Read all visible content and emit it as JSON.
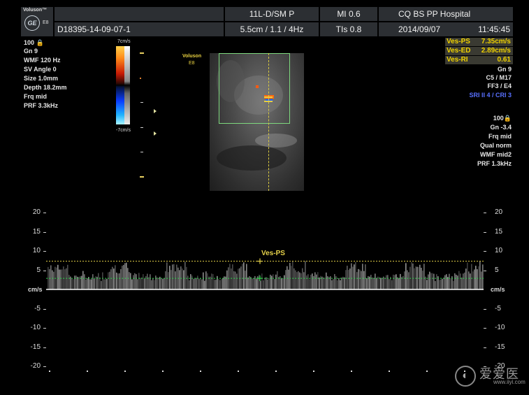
{
  "header": {
    "brand": "Voluson™",
    "model": "E8",
    "patient_id": "D18395-14-09-07-1",
    "probe": "11L-D/SM P",
    "depth_info": "5.5cm / 1.1 / 4Hz",
    "mi": "MI  0.6",
    "tis": "TIs  0.8",
    "hospital": "CQ BS PP Hospital",
    "date": "2014/09/07",
    "time": "11:45:45"
  },
  "left_params": [
    "100 🔒",
    "Gn  9",
    "WMF 120 Hz",
    "SV Angle  0",
    "Size  1.0mm",
    "Depth 18.2mm",
    "Frq mid",
    "PRF  3.3kHz"
  ],
  "color_bar": {
    "top_label": "7cm/s",
    "bottom_label": "-7cm/s"
  },
  "measurements": [
    {
      "label": "Ves-PS",
      "value": "7.35cm/s"
    },
    {
      "label": "Ves-ED",
      "value": "2.89cm/s"
    },
    {
      "label": "Ves-RI",
      "value": "0.61"
    }
  ],
  "right_params_top": [
    "Gn  9",
    "C5 / M17",
    "FF3 / E4"
  ],
  "right_params_blue": "SRI II 4 / CRI 3",
  "right_params_bottom": [
    "100🔒",
    "Gn -3.4",
    "Frq mid",
    "Qual norm",
    "WMF mid2",
    "PRF  1.3kHz"
  ],
  "bmode_label": {
    "brand": "Voluson",
    "model": "E8"
  },
  "doppler": {
    "ticks": [
      "20",
      "15",
      "10",
      "5",
      "-",
      "-5",
      "-10",
      "-15",
      "-20"
    ],
    "tick_values": [
      20,
      15,
      10,
      5,
      0,
      -5,
      -10,
      -15,
      -20
    ],
    "unit": "cm/s",
    "ves_ps_label": "Ves-PS",
    "ps_value": 7.35,
    "ed_value": 2.89,
    "colors": {
      "ps_line": "#e6d24a",
      "ed_line": "#2ed24a",
      "spectrum": "#d8d8d8"
    }
  },
  "watermark": {
    "text": "爱爱医",
    "url": "www.iiyi.com"
  }
}
